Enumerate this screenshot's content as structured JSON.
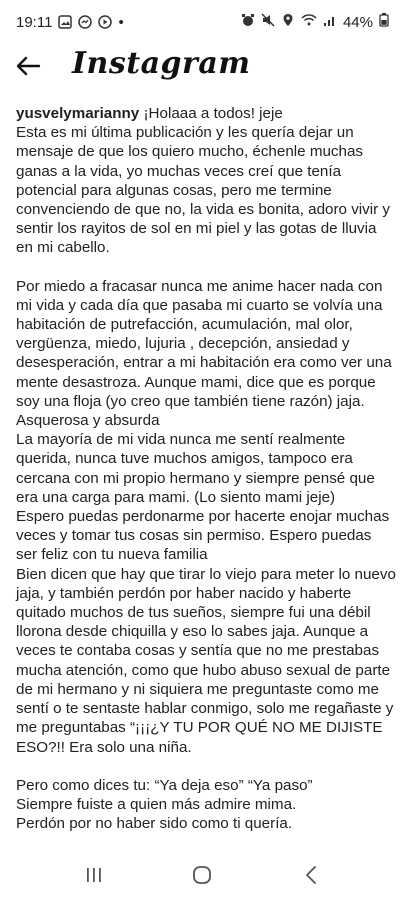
{
  "status": {
    "time": "19:11",
    "battery": "44%"
  },
  "header": {
    "title": "Instagram"
  },
  "post": {
    "username": "yusvelymarianny",
    "caption_first": "¡Holaaa a todos! jeje",
    "paragraphs": [
      "Esta es mi última publicación y les quería dejar un mensaje de que los quiero mucho, échenle muchas ganas a la vida, yo muchas veces creí que tenía potencial para algunas cosas, pero me termine convenciendo de que no, la vida es bonita, adoro vivir y sentir los rayitos de sol en mi piel y las gotas de lluvia en mi cabello.",
      "",
      "Por miedo a fracasar nunca me anime hacer nada con mi vida y cada día que pasaba mi cuarto se volvía una habitación de putrefacción, acumulación, mal olor, vergüenza, miedo, lujuria , decepción, ansiedad y desesperación, entrar a mi habitación era como ver una mente desastroza. Aunque mami, dice que es porque soy una floja (yo creo que también tiene razón) jaja.",
      "Asquerosa y absurda",
      "La mayoría de mi vida nunca me sentí realmente querida, nunca tuve muchos amigos, tampoco era cercana con mi propio hermano y siempre pensé que era una carga para mami. (Lo siento mami jeje)",
      "Espero puedas perdonarme por hacerte enojar muchas veces y tomar tus cosas sin permiso. Espero puedas ser feliz con tu nueva familia",
      "Bien dicen que hay que tirar lo viejo para meter lo nuevo jaja, y también perdón por haber nacido y haberte quitado muchos de tus sueños, siempre fui una débil llorona desde chiquilla y eso lo sabes jaja. Aunque a veces te contaba cosas y sentía que no me prestabas mucha atención, como que hubo abuso sexual de parte de mi hermano y ni siquiera me preguntaste como me sentí o te sentaste hablar conmigo, solo me regañaste y me preguntabas “¡¡¡¿Y TU POR QUÉ NO ME DIJISTE ESO?!! Era solo una niña.",
      "",
      "Pero como dices tu: “Ya deja eso” “Ya paso”",
      "Siempre fuiste a quien más admire mima.",
      "Perdón por no haber sido como ti quería."
    ]
  }
}
